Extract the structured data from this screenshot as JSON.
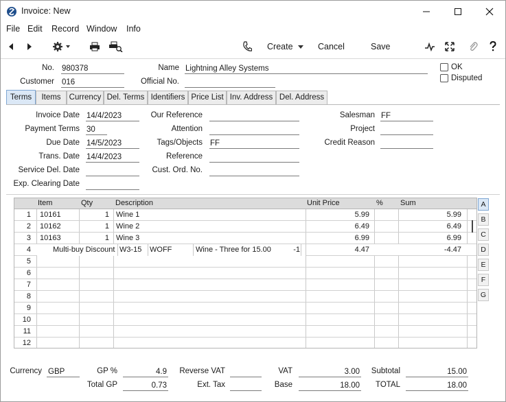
{
  "window": {
    "title": "Invoice: New"
  },
  "menu": [
    "File",
    "Edit",
    "Record",
    "Window",
    "Info"
  ],
  "toolbar": {
    "create_label": "Create",
    "cancel_label": "Cancel",
    "save_label": "Save"
  },
  "header": {
    "no_label": "No.",
    "no_value": "980378",
    "name_label": "Name",
    "name_value": "Lightning Alley Systems",
    "customer_label": "Customer",
    "customer_value": "016",
    "official_no_label": "Official No.",
    "official_no_value": "",
    "ok_label": "OK",
    "disputed_label": "Disputed"
  },
  "tabs": [
    "Terms",
    "Items",
    "Currency",
    "Del. Terms",
    "Identifiers",
    "Price List",
    "Inv. Address",
    "Del. Address"
  ],
  "terms": {
    "invoice_date_label": "Invoice Date",
    "invoice_date": "14/4/2023",
    "payment_terms_label": "Payment Terms",
    "payment_terms": "30",
    "due_date_label": "Due Date",
    "due_date": "14/5/2023",
    "trans_date_label": "Trans. Date",
    "trans_date": "14/4/2023",
    "service_del_date_label": "Service Del. Date",
    "service_del_date": "",
    "exp_clearing_date_label": "Exp. Clearing Date",
    "exp_clearing_date": "",
    "our_reference_label": "Our Reference",
    "our_reference": "",
    "attention_label": "Attention",
    "attention": "",
    "tags_label": "Tags/Objects",
    "tags": "FF",
    "reference_label": "Reference",
    "reference": "",
    "cust_ord_no_label": "Cust. Ord. No.",
    "cust_ord_no": "",
    "salesman_label": "Salesman",
    "salesman": "FF",
    "project_label": "Project",
    "project": "",
    "credit_reason_label": "Credit Reason",
    "credit_reason": ""
  },
  "grid": {
    "columns": {
      "item": "Item",
      "qty": "Qty",
      "description": "Description",
      "unit_price": "Unit Price",
      "pct": "%",
      "sum": "Sum"
    },
    "rows": [
      {
        "n": "1",
        "item": "10161",
        "qty": "1",
        "description": "Wine 1",
        "unit_price": "5.99",
        "sum": "5.99"
      },
      {
        "n": "2",
        "item": "10162",
        "qty": "1",
        "description": "Wine 2",
        "unit_price": "6.49",
        "sum": "6.49"
      },
      {
        "n": "3",
        "item": "10163",
        "qty": "1",
        "description": "Wine 3",
        "unit_price": "6.99",
        "sum": "6.99"
      }
    ],
    "discount_row": {
      "n": "4",
      "label": "Multi-buy Discount",
      "code": "W3-15",
      "type": "WOFF",
      "description": "Wine - Three for 15.00",
      "qty": "-1",
      "unit_price": "4.47",
      "sum": "-4.47"
    },
    "empty_rows": [
      "5",
      "6",
      "7",
      "8",
      "9",
      "10",
      "11",
      "12"
    ],
    "side_tabs": [
      "A",
      "B",
      "C",
      "D",
      "E",
      "F",
      "G"
    ]
  },
  "footer": {
    "currency_label": "Currency",
    "currency": "GBP",
    "gp_pct_label": "GP %",
    "gp_pct": "4.9",
    "total_gp_label": "Total GP",
    "total_gp": "0.73",
    "reverse_vat_label": "Reverse VAT",
    "reverse_vat": "",
    "ext_tax_label": "Ext. Tax",
    "ext_tax": "",
    "vat_label": "VAT",
    "vat": "3.00",
    "base_label": "Base",
    "base": "18.00",
    "subtotal_label": "Subtotal",
    "subtotal": "15.00",
    "total_label": "TOTAL",
    "total": "18.00"
  }
}
